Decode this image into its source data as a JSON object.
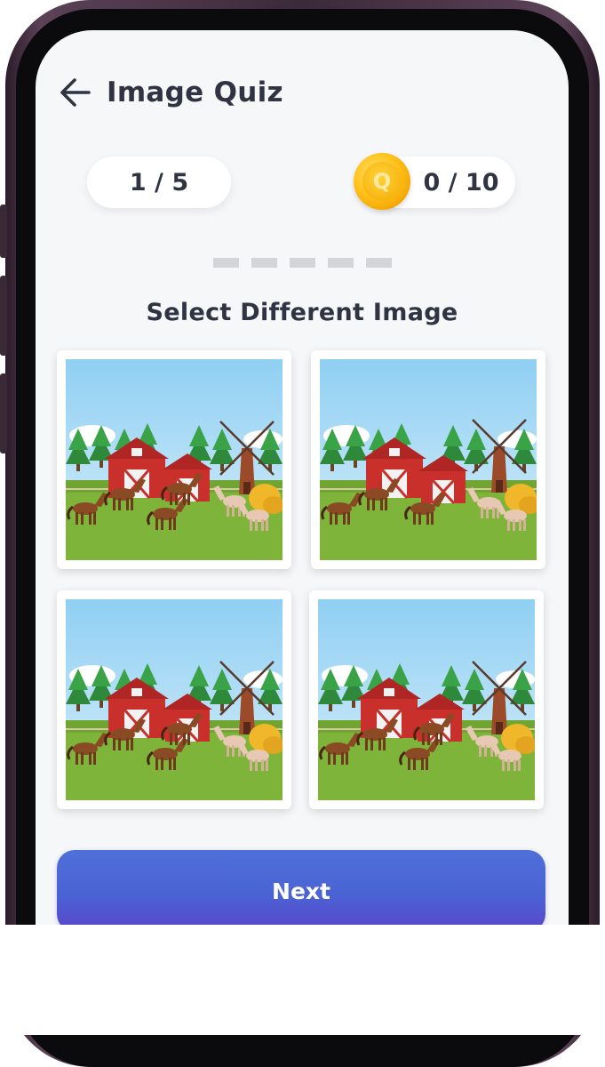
{
  "header": {
    "title": "Image Quiz",
    "back_icon": "arrow-left-icon"
  },
  "progress": {
    "label": "1 / 5",
    "current": 1,
    "total": 5
  },
  "score": {
    "label": "0 / 10",
    "coin_letter": "Q",
    "coin_icon": "coin-icon"
  },
  "steps": {
    "count": 5
  },
  "quiz": {
    "prompt": "Select Different Image",
    "options": [
      {
        "label": "image-option-1",
        "variant": "four-horses-group-flipped-windmill"
      },
      {
        "label": "image-option-2",
        "variant": "three-horses-right-windmill"
      },
      {
        "label": "image-option-3",
        "variant": "four-horses-group-flipped-windmill"
      },
      {
        "label": "image-option-4",
        "variant": "four-horses-group-flipped-windmill"
      }
    ]
  },
  "actions": {
    "next_label": "Next"
  },
  "colors": {
    "accent": "#4a63d4",
    "text": "#2f3342",
    "coin": "#ffc21a",
    "background": "#f6f7f9"
  }
}
